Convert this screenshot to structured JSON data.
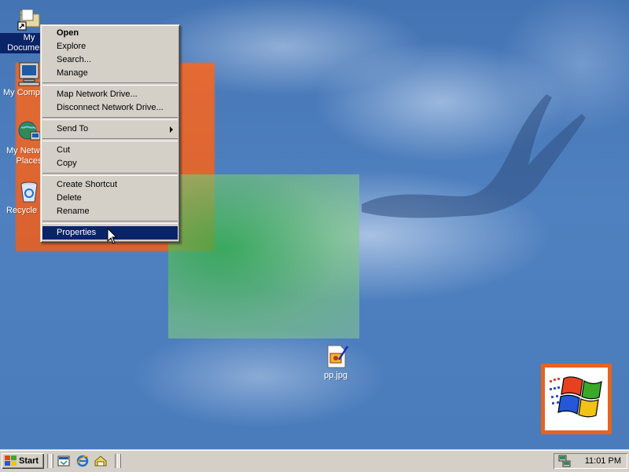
{
  "desktop": {
    "icons": [
      {
        "label": "My Documents",
        "icon": "my-documents-icon"
      },
      {
        "label": "My Computer",
        "icon": "my-computer-icon"
      },
      {
        "label": "My Network Places",
        "icon": "network-places-icon"
      },
      {
        "label": "Recycle Bin",
        "icon": "recycle-bin-icon"
      },
      {
        "label": "pp.jpg",
        "icon": "image-file-icon"
      }
    ]
  },
  "context_menu": {
    "items": [
      {
        "label": "Open",
        "bold": true
      },
      {
        "label": "Explore"
      },
      {
        "label": "Search..."
      },
      {
        "label": "Manage"
      },
      {
        "label": "Map Network Drive..."
      },
      {
        "label": "Disconnect Network Drive..."
      },
      {
        "label": "Send To",
        "submenu": true
      },
      {
        "label": "Cut"
      },
      {
        "label": "Copy"
      },
      {
        "label": "Create Shortcut"
      },
      {
        "label": "Delete"
      },
      {
        "label": "Rename"
      },
      {
        "label": "Properties",
        "highlighted": true
      }
    ]
  },
  "taskbar": {
    "start_label": "Start",
    "quick_launch": [
      "show-desktop-icon",
      "internet-explorer-icon",
      "outlook-express-icon"
    ],
    "tray_icons": [
      "network-connection-icon"
    ],
    "clock": "11:01 PM"
  },
  "colors": {
    "selection": "#0a246a",
    "desktop_blue": "#4a7cbc",
    "system_gray": "#d4d0c8"
  }
}
